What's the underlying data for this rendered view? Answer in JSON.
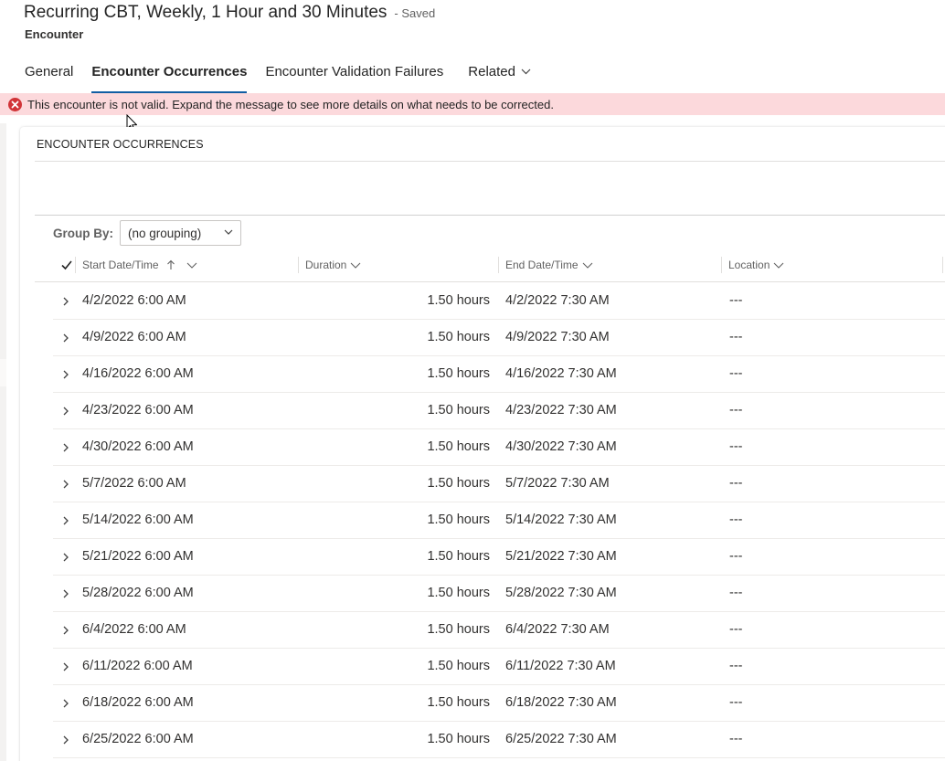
{
  "header": {
    "title": "Recurring CBT, Weekly, 1 Hour and 30 Minutes",
    "status": "- Saved",
    "entity": "Encounter"
  },
  "tabs": [
    {
      "label": "General",
      "active": false
    },
    {
      "label": "Encounter Occurrences",
      "active": true
    },
    {
      "label": "Encounter Validation Failures",
      "active": false
    },
    {
      "label": "Related",
      "active": false
    }
  ],
  "error_banner": {
    "icon": "error-circle-icon",
    "text": "This encounter is not valid. Expand the message to see more details on what needs to be corrected.",
    "color": "#fcd9dc"
  },
  "section": {
    "title": "ENCOUNTER OCCURRENCES"
  },
  "group_by": {
    "label": "Group By:",
    "value": "(no grouping)"
  },
  "grid": {
    "columns": [
      {
        "label": "Start Date/Time",
        "sort": "ascending"
      },
      {
        "label": "Duration"
      },
      {
        "label": "End Date/Time"
      },
      {
        "label": "Location"
      }
    ],
    "rows": [
      {
        "start": "4/2/2022 6:00 AM",
        "duration": "1.50 hours",
        "end": "4/2/2022 7:30 AM",
        "location": "---"
      },
      {
        "start": "4/9/2022 6:00 AM",
        "duration": "1.50 hours",
        "end": "4/9/2022 7:30 AM",
        "location": "---"
      },
      {
        "start": "4/16/2022 6:00 AM",
        "duration": "1.50 hours",
        "end": "4/16/2022 7:30 AM",
        "location": "---"
      },
      {
        "start": "4/23/2022 6:00 AM",
        "duration": "1.50 hours",
        "end": "4/23/2022 7:30 AM",
        "location": "---"
      },
      {
        "start": "4/30/2022 6:00 AM",
        "duration": "1.50 hours",
        "end": "4/30/2022 7:30 AM",
        "location": "---"
      },
      {
        "start": "5/7/2022 6:00 AM",
        "duration": "1.50 hours",
        "end": "5/7/2022 7:30 AM",
        "location": "---"
      },
      {
        "start": "5/14/2022 6:00 AM",
        "duration": "1.50 hours",
        "end": "5/14/2022 7:30 AM",
        "location": "---"
      },
      {
        "start": "5/21/2022 6:00 AM",
        "duration": "1.50 hours",
        "end": "5/21/2022 7:30 AM",
        "location": "---"
      },
      {
        "start": "5/28/2022 6:00 AM",
        "duration": "1.50 hours",
        "end": "5/28/2022 7:30 AM",
        "location": "---"
      },
      {
        "start": "6/4/2022 6:00 AM",
        "duration": "1.50 hours",
        "end": "6/4/2022 7:30 AM",
        "location": "---"
      },
      {
        "start": "6/11/2022 6:00 AM",
        "duration": "1.50 hours",
        "end": "6/11/2022 7:30 AM",
        "location": "---"
      },
      {
        "start": "6/18/2022 6:00 AM",
        "duration": "1.50 hours",
        "end": "6/18/2022 7:30 AM",
        "location": "---"
      },
      {
        "start": "6/25/2022 6:00 AM",
        "duration": "1.50 hours",
        "end": "6/25/2022 7:30 AM",
        "location": "---"
      }
    ]
  },
  "colors": {
    "accent": "#115ea3",
    "error": "#d13438"
  }
}
